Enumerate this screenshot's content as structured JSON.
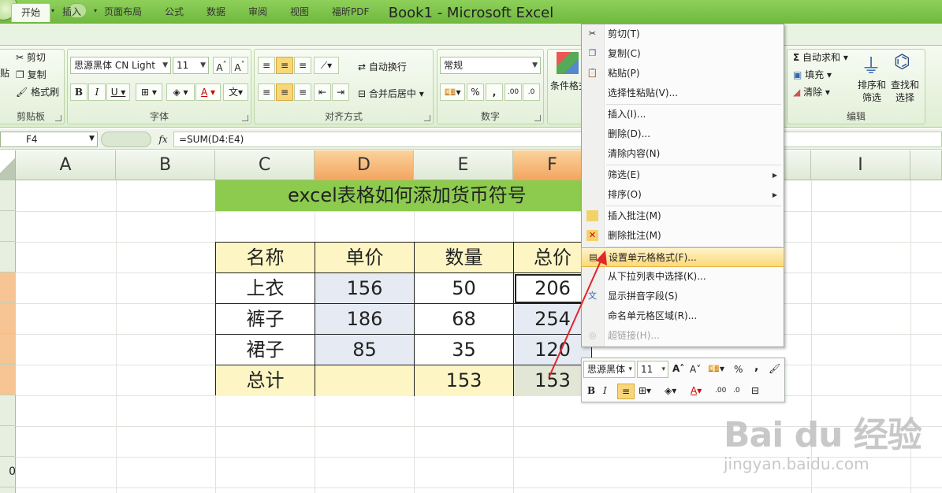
{
  "window": {
    "title": "Book1 - Microsoft Excel"
  },
  "tabs": [
    {
      "label": "开始",
      "active": true
    },
    {
      "label": "插入"
    },
    {
      "label": "页面布局"
    },
    {
      "label": "公式"
    },
    {
      "label": "数据"
    },
    {
      "label": "审阅"
    },
    {
      "label": "视图"
    },
    {
      "label": "福昕PDF"
    }
  ],
  "ribbon": {
    "clipboard": {
      "cut": "剪切",
      "copy": "复制",
      "paste_partial": "贴",
      "format_painter": "格式刷",
      "label": "剪贴板"
    },
    "font": {
      "font_name": "思源黑体 CN Light",
      "font_size": "11",
      "label": "字体"
    },
    "alignment": {
      "wrap": "自动换行",
      "merge": "合并后居中",
      "label": "对齐方式"
    },
    "number": {
      "format": "常规",
      "percent": "%",
      "comma": ",",
      "label": "数字"
    },
    "styles": {
      "cond_format": "条件格式"
    },
    "editing": {
      "autosum": "自动求和",
      "fill": "填充",
      "clear": "清除",
      "sort_filter": "排序和\n筛选",
      "sort_line1": "排序和",
      "sort_line2": "筛选",
      "find_line1": "查找和",
      "find_line2": "选择",
      "label": "编辑"
    }
  },
  "formula_bar": {
    "name_box": "F4",
    "fx": "fx",
    "formula": "=SUM(D4:E4)"
  },
  "columns": [
    "A",
    "B",
    "C",
    "D",
    "E",
    "F",
    "I"
  ],
  "row_head_tail": "0",
  "sheet": {
    "banner": "excel表格如何添加货币符号",
    "headers": [
      "名称",
      "单价",
      "数量",
      "总价"
    ],
    "rows": [
      [
        "上衣",
        "156",
        "50",
        "206"
      ],
      [
        "裤子",
        "186",
        "68",
        "254"
      ],
      [
        "裙子",
        "85",
        "35",
        "120"
      ],
      [
        "总计",
        "",
        "153",
        "153"
      ]
    ]
  },
  "context_menu": {
    "items": [
      {
        "label": "剪切(T)",
        "icon": "scissors-icon"
      },
      {
        "label": "复制(C)",
        "icon": "copy-icon"
      },
      {
        "label": "粘贴(P)",
        "icon": "paste-icon"
      },
      {
        "label": "选择性粘贴(V)..."
      },
      {
        "label": "插入(I)..."
      },
      {
        "label": "删除(D)..."
      },
      {
        "label": "清除内容(N)"
      },
      {
        "label": "筛选(E)",
        "submenu": true
      },
      {
        "label": "排序(O)",
        "submenu": true
      },
      {
        "label": "插入批注(M)",
        "icon": "insert-comment-icon"
      },
      {
        "label": "删除批注(M)",
        "icon": "delete-comment-icon"
      },
      {
        "label": "设置单元格格式(F)...",
        "icon": "format-cells-icon",
        "highlighted": true
      },
      {
        "label": "从下拉列表中选择(K)..."
      },
      {
        "label": "显示拼音字段(S)",
        "icon": "phonetic-icon"
      },
      {
        "label": "命名单元格区域(R)..."
      },
      {
        "label": "超链接(H)...",
        "icon": "hyperlink-icon",
        "disabled": true
      }
    ]
  },
  "mini_toolbar": {
    "font_name": "思源黑体",
    "font_size": "11",
    "percent": "%",
    "comma": ","
  },
  "watermark": {
    "logo": "Bai du 经验",
    "url": "jingyan.baidu.com"
  },
  "colors": {
    "title_green": "#7bc04a",
    "banner_green": "#8ccb4e",
    "header_yellow": "#fdf6c4",
    "selected_orange": "#f6c593",
    "annotation_red": "#e0262b"
  }
}
